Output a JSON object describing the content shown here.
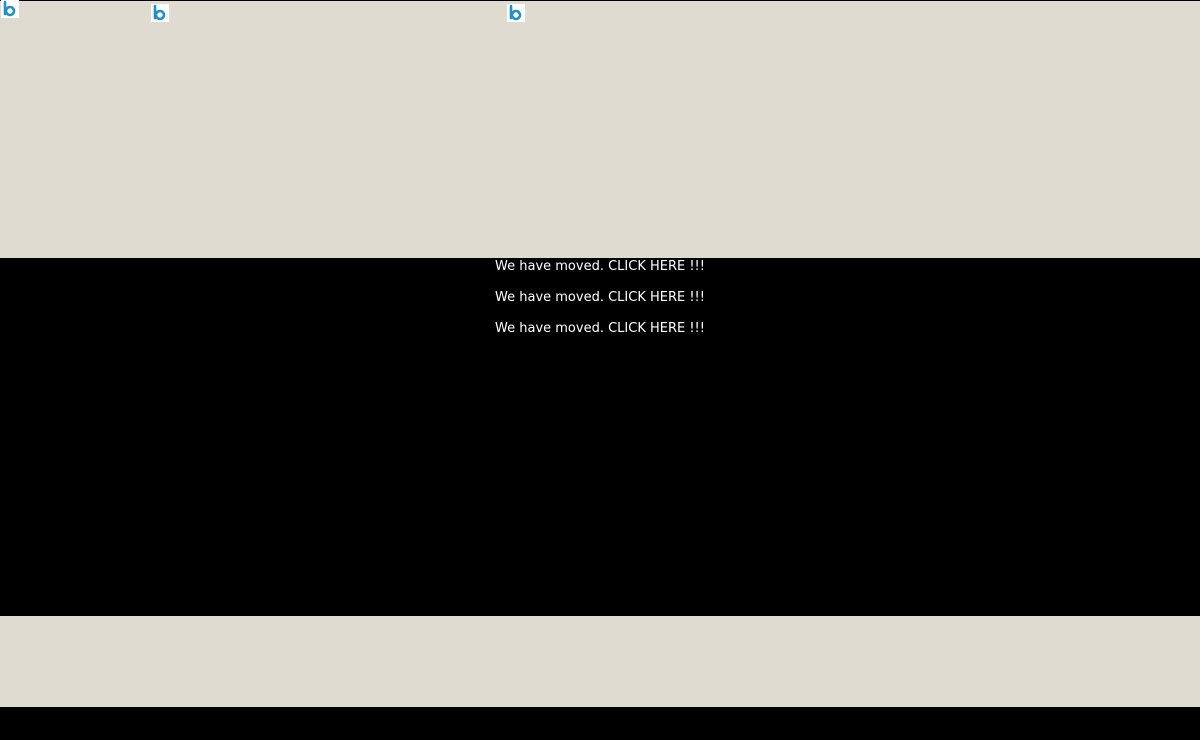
{
  "colors": {
    "band": "#dfdbd0",
    "black": "#000000",
    "text": "#ffffff",
    "logo_blue": "#1f8fd1"
  },
  "header": {
    "logos": [
      {
        "icon": "b-logo-icon"
      },
      {
        "icon": "b-logo-icon"
      },
      {
        "icon": "b-logo-icon"
      }
    ]
  },
  "main": {
    "links": [
      {
        "label": "We have moved. CLICK HERE !!!"
      },
      {
        "label": "We have moved. CLICK HERE !!!"
      },
      {
        "label": "We have moved. CLICK HERE !!!"
      }
    ]
  }
}
